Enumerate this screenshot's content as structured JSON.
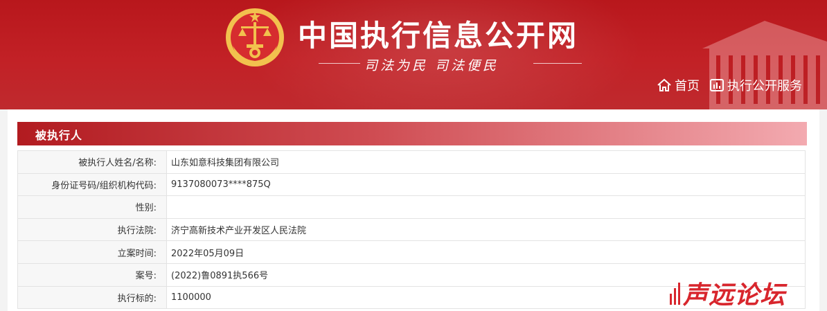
{
  "header": {
    "site_title": "中国执行信息公开网",
    "slogan": "司法为民  司法便民",
    "nav": {
      "home_label": "首页",
      "service_label": "执行公开服务"
    }
  },
  "section": {
    "title": "被执行人"
  },
  "rows": [
    {
      "label": "被执行人姓名/名称:",
      "value": "山东如意科技集团有限公司"
    },
    {
      "label": "身份证号码/组织机构代码:",
      "value": "9137080073****875Q"
    },
    {
      "label": "性别:",
      "value": ""
    },
    {
      "label": "执行法院:",
      "value": "济宁高新技术产业开发区人民法院"
    },
    {
      "label": "立案时间:",
      "value": "2022年05月09日"
    },
    {
      "label": "案号:",
      "value": "(2022)鲁0891执566号"
    },
    {
      "label": "执行标的:",
      "value": "1100000"
    }
  ],
  "watermark": {
    "text": "声远论坛"
  },
  "colors": {
    "brand_red": "#c22126",
    "emblem_gold": "#f2c14e"
  }
}
